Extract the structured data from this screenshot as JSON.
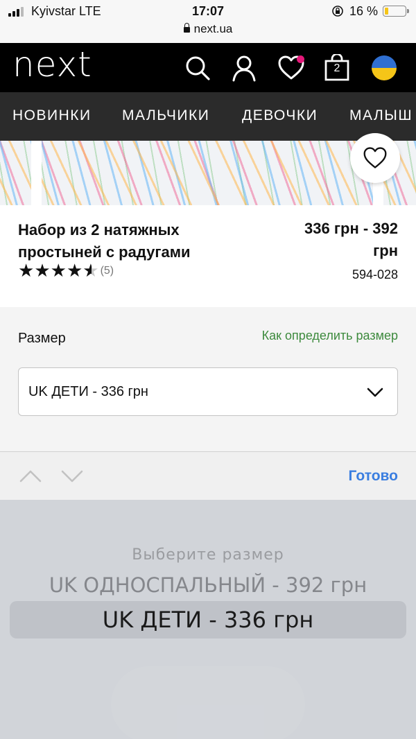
{
  "status_bar": {
    "carrier": "Kyivstar  LTE",
    "time": "17:07",
    "battery": "16 %",
    "battery_level": 0.16,
    "url": "next.ua"
  },
  "header": {
    "logo": "next",
    "cart_count": "2",
    "wishlist_badge_color": "#e6197a",
    "flag_colors": [
      "#2f6fd1",
      "#f5c518"
    ]
  },
  "nav": {
    "items": [
      "НОВИНКИ",
      "МАЛЬЧИКИ",
      "ДЕВОЧКИ",
      "МАЛЫШ"
    ]
  },
  "product": {
    "title_line1": "Набор из 2 натяжных",
    "title_line2": "простыней с радугами",
    "price_line1": "336 грн - 392",
    "price_line2": "грн",
    "rating": 4.5,
    "review_count": "(5)",
    "code": "594-028"
  },
  "size": {
    "label": "Размер",
    "guide_link": "Как определить размер",
    "selected": "UK ДЕТИ - 336 грн"
  },
  "picker": {
    "done": "Готово",
    "options": [
      "Выберите размер",
      "UK ОДНОСПАЛЬНЫЙ - 392 грн",
      "UK ДЕТИ - 336 грн"
    ]
  }
}
